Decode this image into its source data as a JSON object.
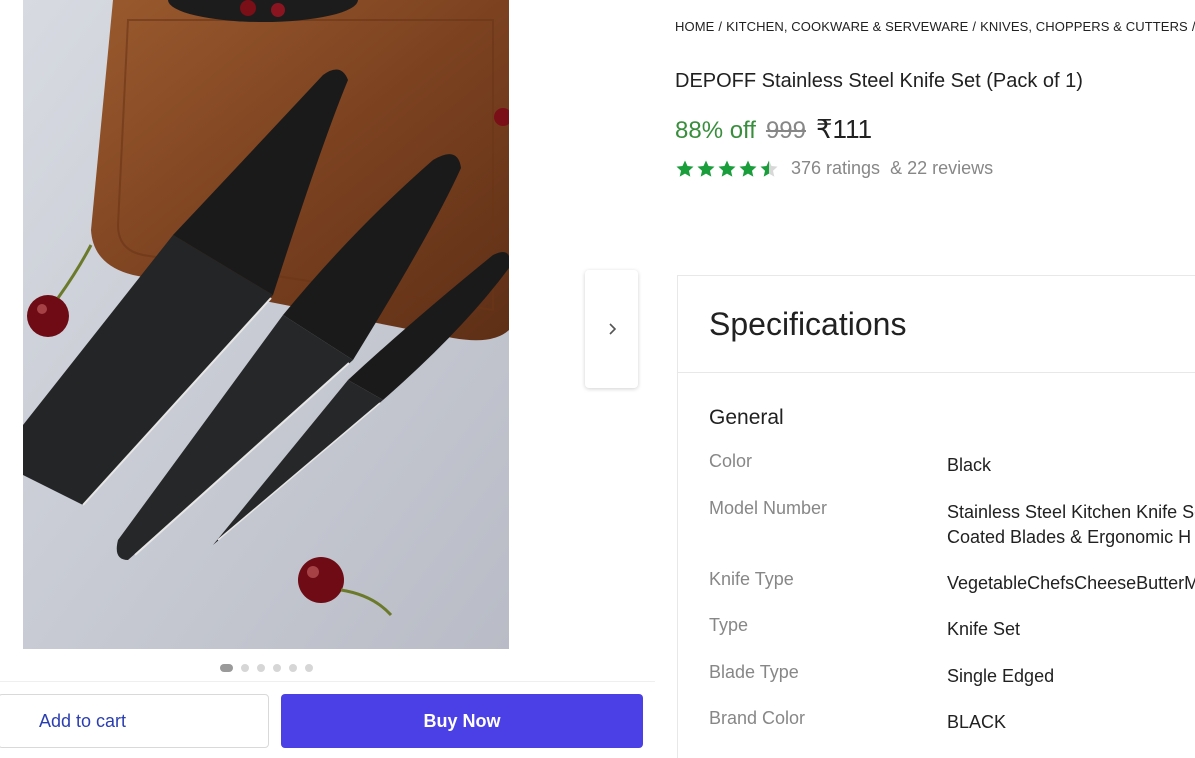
{
  "breadcrumb": [
    "HOME",
    "KITCHEN, COOKWARE & SERVEWARE",
    "KNIVES, CHOPPERS & CUTTERS"
  ],
  "breadcrumb_sep": "/",
  "product": {
    "title": "DEPOFF Stainless Steel Knife Set (Pack of 1)",
    "discount": "88% off",
    "mrp": "999",
    "price": "₹111",
    "rating_stars": 4.5,
    "rating_text": "376 ratings",
    "reviews_text": "& 22 reviews"
  },
  "gallery": {
    "dots_total": 6,
    "active_index": 0
  },
  "actions": {
    "add_to_cart": "Add to cart",
    "buy_now": "Buy Now"
  },
  "specs": {
    "heading": "Specifications",
    "group": "General",
    "rows": [
      {
        "key": "Color",
        "value": "Black"
      },
      {
        "key": "Model Number",
        "value": "Stainless Steel Kitchen Knife Se\nCoated Blades & Ergonomic H"
      },
      {
        "key": "Knife Type",
        "value": "VegetableChefsCheeseButterM"
      },
      {
        "key": "Type",
        "value": "Knife Set"
      },
      {
        "key": "Blade Type",
        "value": "Single Edged"
      },
      {
        "key": "Brand Color",
        "value": "BLACK"
      }
    ]
  },
  "colors": {
    "discount_green": "#388e3c",
    "star_green": "#1a9e3c",
    "buy_now_bg": "#4b3fe6",
    "link_blue": "#2a3eb1"
  },
  "icons": {
    "next": "chevron-right-icon",
    "star": "star-icon"
  }
}
